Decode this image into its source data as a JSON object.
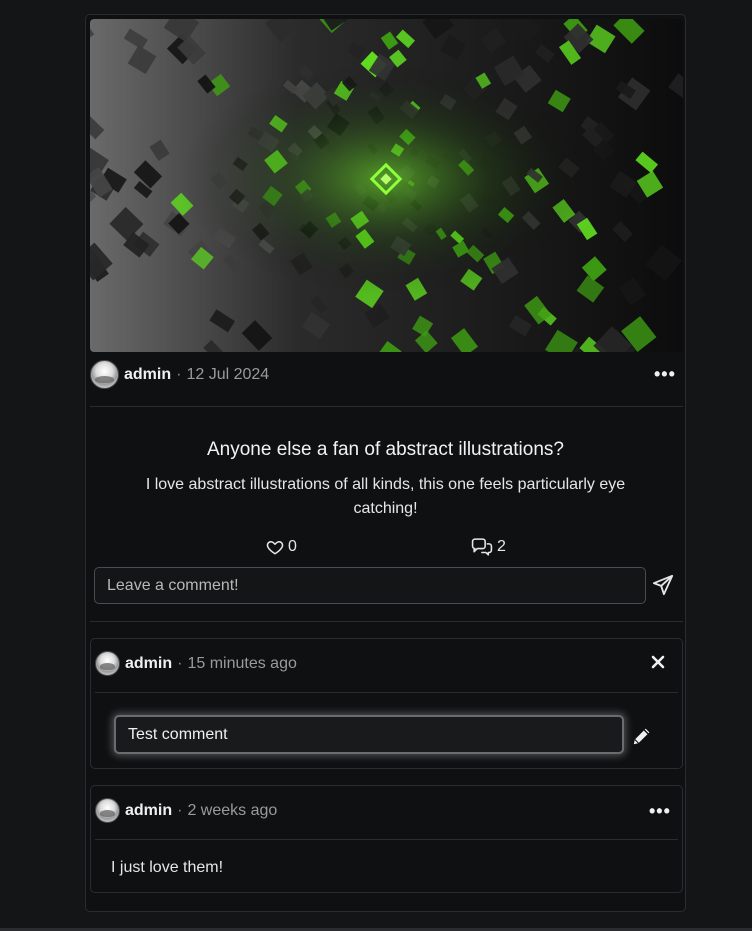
{
  "post": {
    "author": "admin",
    "separator": "·",
    "date": "12 Jul 2024",
    "title": "Anyone else a fan of abstract illustrations?",
    "description": "I love abstract illustrations of all kinds, this one feels particularly eye catching!",
    "likes": "0",
    "comments_count": "2",
    "menu_icon": "more-horizontal-icon"
  },
  "comment_form": {
    "placeholder": "Leave a comment!",
    "value": ""
  },
  "comments": [
    {
      "author": "admin",
      "separator": "·",
      "time": "15 minutes ago",
      "edit_value": "Test comment",
      "editing": true
    },
    {
      "author": "admin",
      "separator": "·",
      "time": "2 weeks ago",
      "text": "I just love them!",
      "editing": false
    }
  ],
  "colors": {
    "background": "#141517",
    "card": "#0f1012",
    "border": "#2a2c30",
    "accent_green": "#5fdc1f"
  }
}
